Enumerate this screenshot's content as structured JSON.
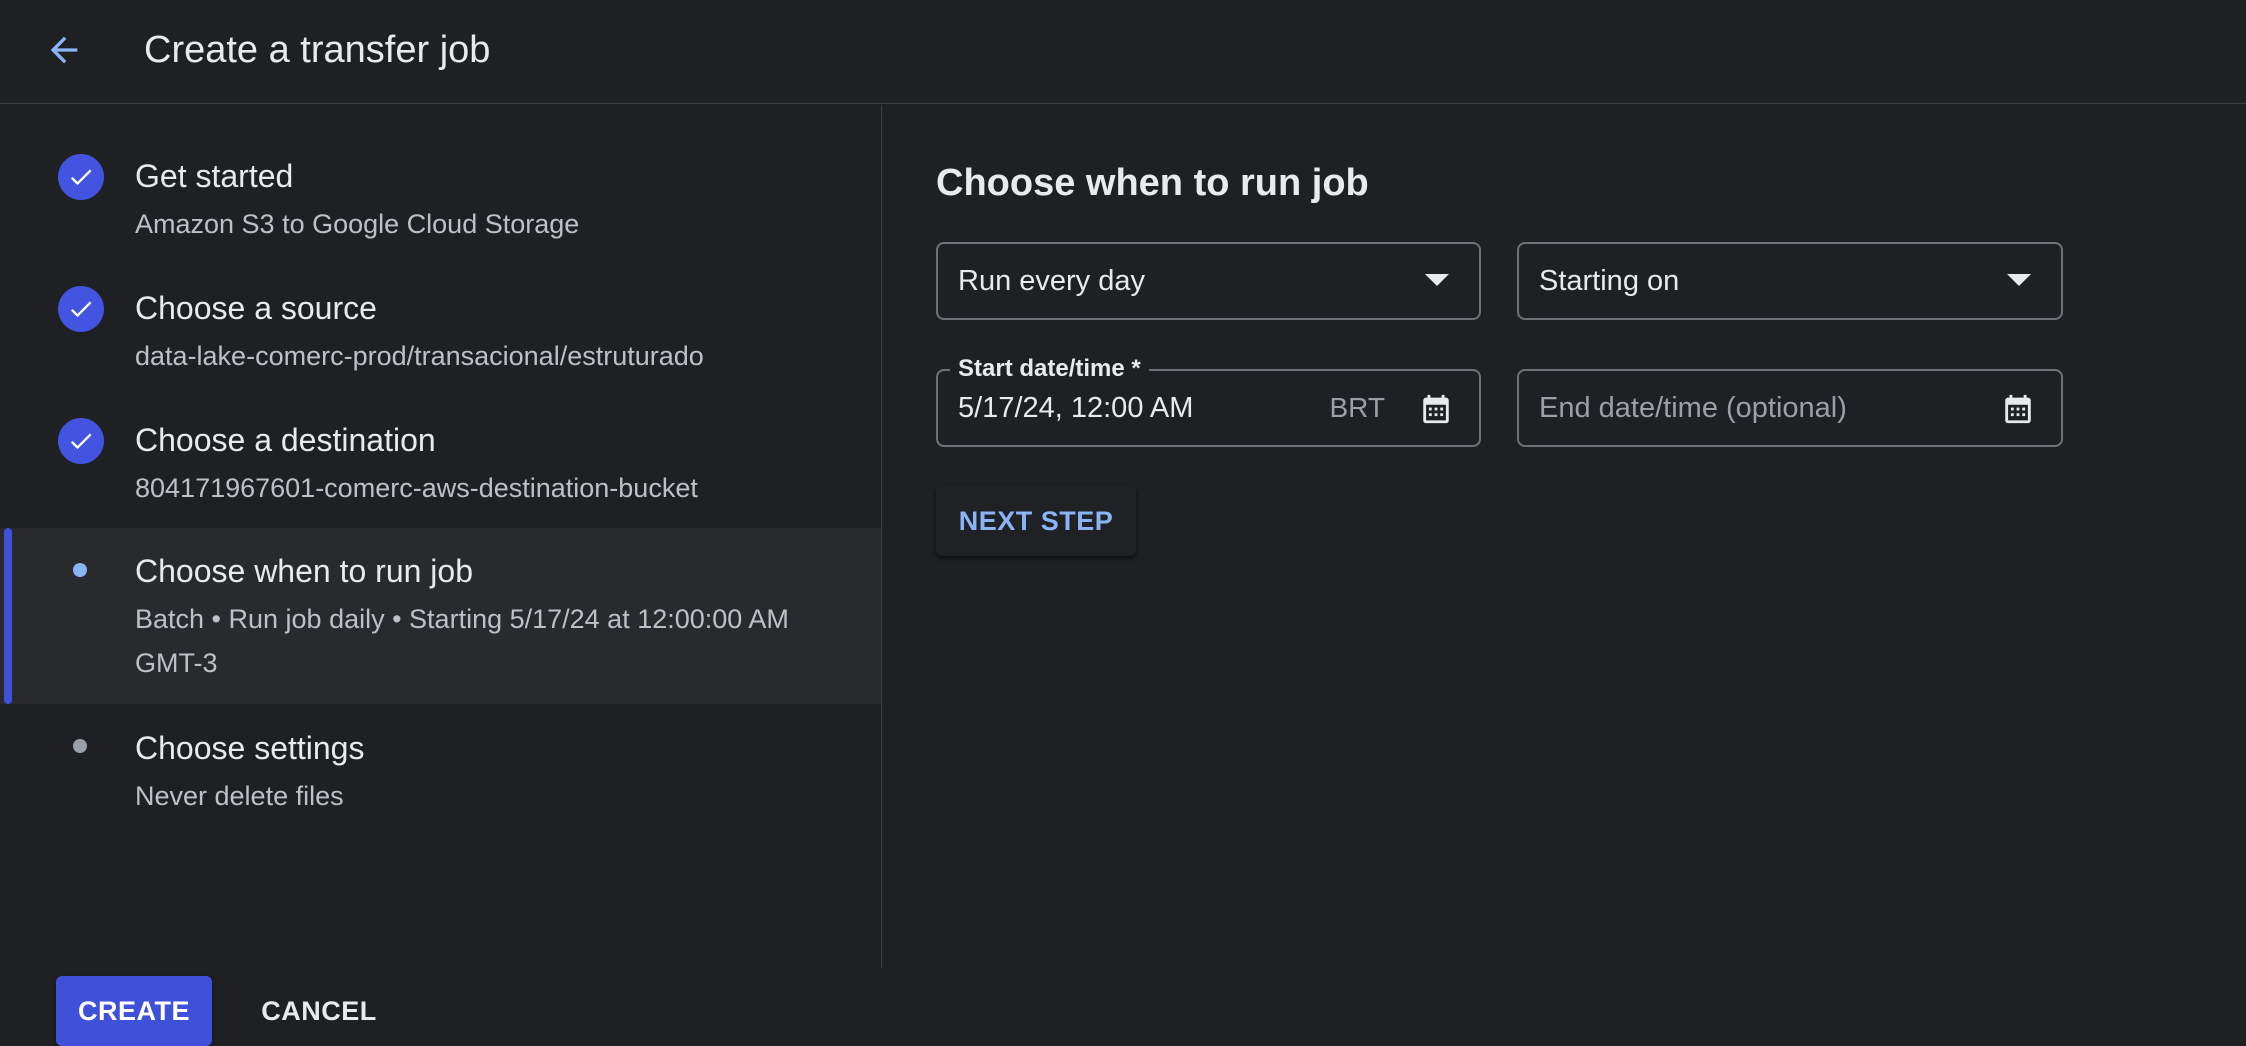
{
  "header": {
    "title": "Create a transfer job",
    "back_icon": "arrow-back-icon"
  },
  "steps": [
    {
      "title": "Get started",
      "subtitle": "Amazon S3 to Google Cloud Storage",
      "status": "complete"
    },
    {
      "title": "Choose a source",
      "subtitle": "data-lake-comerc-prod/transacional/estruturado",
      "status": "complete"
    },
    {
      "title": "Choose a destination",
      "subtitle": "804171967601-comerc-aws-destination-bucket",
      "status": "complete"
    },
    {
      "title": "Choose when to run job",
      "subtitle": "Batch • Run job daily • Starting 5/17/24 at 12:00:00 AM GMT-3",
      "status": "current"
    },
    {
      "title": "Choose settings",
      "subtitle": "Never delete files",
      "status": "pending"
    }
  ],
  "actions": {
    "create_label": "CREATE",
    "cancel_label": "CANCEL"
  },
  "main": {
    "heading": "Choose when to run job",
    "frequency_select": {
      "value": "Run every day"
    },
    "start_mode_select": {
      "value": "Starting on"
    },
    "start_datetime": {
      "label": "Start date/time *",
      "value": "5/17/24, 12:00 AM",
      "timezone": "BRT"
    },
    "end_datetime": {
      "placeholder": "End date/time (optional)"
    },
    "next_step_label": "NEXT STEP"
  },
  "colors": {
    "background": "#1f2023",
    "accent": "#3f51d8",
    "link": "#8ab4f8",
    "current_dot": "#8ab4f8",
    "pending_dot": "#9aa0a6"
  }
}
